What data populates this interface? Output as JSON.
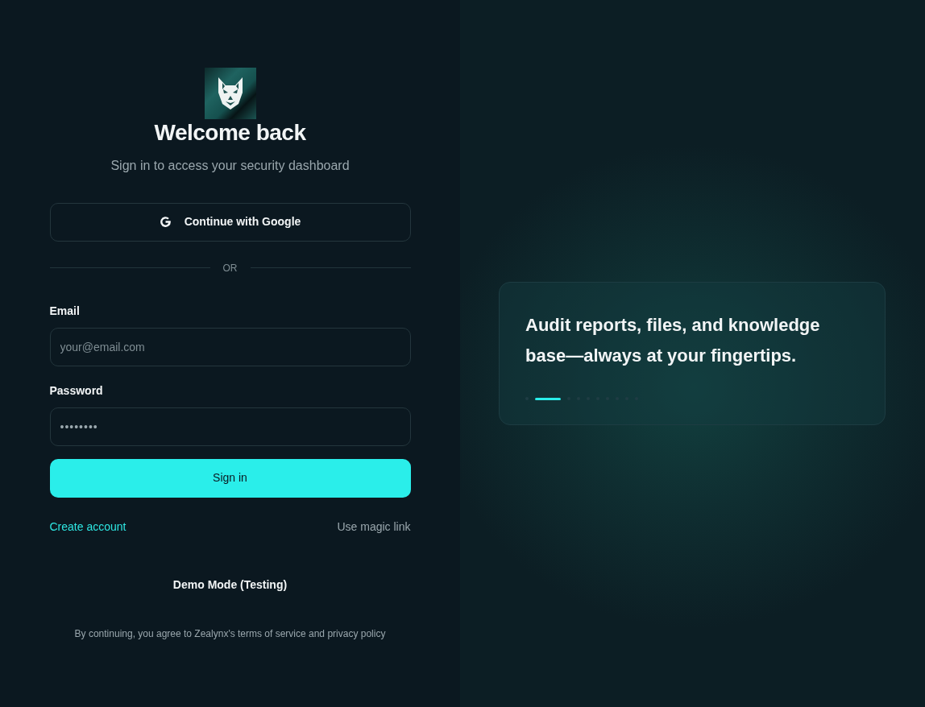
{
  "login": {
    "title": "Welcome back",
    "subtitle": "Sign in to access your security dashboard",
    "google_button": "Continue with Google",
    "divider": "OR",
    "fields": [
      {
        "label": "Email",
        "placeholder": "your@email.com",
        "kind": "text"
      },
      {
        "label": "Password",
        "value": "••••••••",
        "kind": "password"
      }
    ],
    "submit": "Sign in",
    "links": [
      {
        "label": "Create account",
        "kind": "accent"
      },
      {
        "label": "Use magic link",
        "kind": "muted"
      }
    ],
    "demo_button": "Demo Mode (Testing)",
    "footer": "By continuing, you agree to Zealynx's terms of service and privacy policy"
  },
  "showcase": {
    "text": "Audit reports, files, and knowledge base—always at your fingertips.",
    "slides": [
      {
        "selected": false
      },
      {
        "selected": true
      },
      {
        "selected": false
      },
      {
        "selected": false
      },
      {
        "selected": false
      },
      {
        "selected": false
      },
      {
        "selected": false
      },
      {
        "selected": false
      },
      {
        "selected": false
      },
      {
        "selected": false
      }
    ]
  }
}
